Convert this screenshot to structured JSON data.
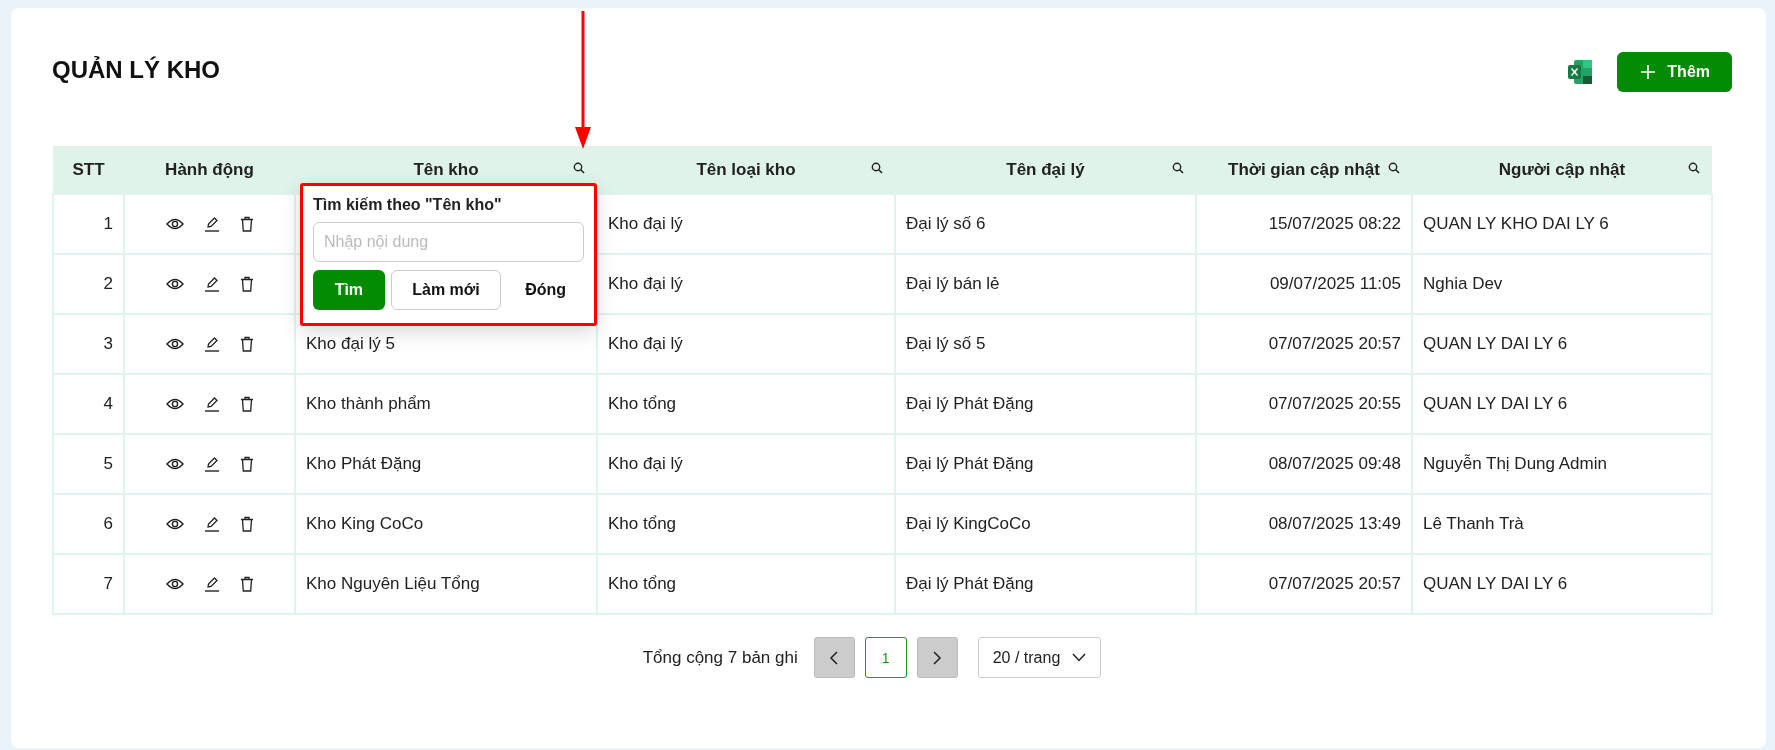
{
  "page": {
    "title": "QUẢN LÝ KHO"
  },
  "toolbar": {
    "add_button": "Thêm"
  },
  "table": {
    "columns": [
      {
        "label": "STT",
        "searchable": false,
        "filter_open": false
      },
      {
        "label": "Hành động",
        "searchable": false,
        "filter_open": false
      },
      {
        "label": "Tên kho",
        "searchable": true,
        "filter_open": true
      },
      {
        "label": "Tên loại kho",
        "searchable": true,
        "filter_open": false
      },
      {
        "label": "Tên đại lý",
        "searchable": true,
        "filter_open": false
      },
      {
        "label": "Thời gian cập nhật",
        "searchable": true,
        "filter_open": false
      },
      {
        "label": "Người cập nhật",
        "searchable": true,
        "filter_open": false
      }
    ],
    "rows": [
      {
        "stt": "1",
        "type": "Kho đại lý",
        "agency": "Đại lý số 6",
        "updated_at": "15/07/2025 08:22",
        "updated_by": "QUAN LY KHO DAI LY 6"
      },
      {
        "stt": "2",
        "type": "Kho đại lý",
        "agency": "Đại lý bán lẻ",
        "updated_at": "09/07/2025 11:05",
        "updated_by": "Nghia Dev"
      },
      {
        "stt": "3",
        "name": "Kho đại lý 5",
        "type": "Kho đại lý",
        "agency": "Đại lý số 5",
        "updated_at": "07/07/2025 20:57",
        "updated_by": "QUAN LY DAI LY 6"
      },
      {
        "stt": "4",
        "name": "Kho thành phẩm",
        "type": "Kho tổng",
        "agency": "Đại lý Phát Đặng",
        "updated_at": "07/07/2025 20:55",
        "updated_by": "QUAN LY DAI LY 6"
      },
      {
        "stt": "5",
        "name": "Kho Phát Đặng",
        "type": "Kho đại lý",
        "agency": "Đại lý Phát Đặng",
        "updated_at": "08/07/2025 09:48",
        "updated_by": "Nguyễn Thị Dung Admin"
      },
      {
        "stt": "6",
        "name": "Kho King CoCo",
        "type": "Kho tổng",
        "agency": "Đại lý KingCoCo",
        "updated_at": "08/07/2025 13:49",
        "updated_by": "Lê Thanh Trà"
      },
      {
        "stt": "7",
        "name": "Kho Nguyên Liệu Tổng",
        "type": "Kho tổng",
        "agency": "Đại lý Phát Đặng",
        "updated_at": "07/07/2025 20:57",
        "updated_by": "QUAN LY DAI LY 6"
      }
    ]
  },
  "filter_popup": {
    "title": "Tìm kiếm theo \"Tên kho\"",
    "placeholder": "Nhập nội dung",
    "buttons": [
      {
        "label": "Tìm",
        "kind": "primary"
      },
      {
        "label": "Làm mới",
        "kind": "default"
      },
      {
        "label": "Đóng",
        "kind": "text"
      }
    ]
  },
  "pagination": {
    "total": "Tổng cộng 7 bản ghi",
    "pages": [
      {
        "label": "1",
        "selected": true
      }
    ],
    "page_size": "20 / trang"
  }
}
